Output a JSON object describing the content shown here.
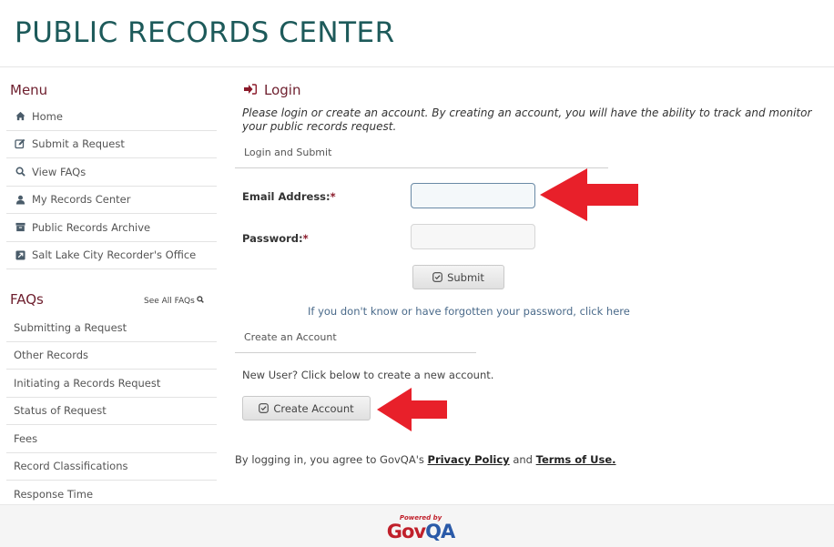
{
  "header": {
    "title": "PUBLIC RECORDS CENTER"
  },
  "sidebar": {
    "menu_title": "Menu",
    "menu_items": [
      {
        "label": "Home",
        "icon": "home-icon"
      },
      {
        "label": "Submit a Request",
        "icon": "edit-icon"
      },
      {
        "label": "View FAQs",
        "icon": "search-icon"
      },
      {
        "label": "My Records Center",
        "icon": "user-icon"
      },
      {
        "label": "Public Records Archive",
        "icon": "archive-icon"
      },
      {
        "label": "Salt Lake City Recorder's Office",
        "icon": "external-link-icon"
      }
    ],
    "faq_title": "FAQs",
    "see_all_label": "See All FAQs",
    "faq_items": [
      "Submitting a Request",
      "Other Records",
      "Initiating a Records Request",
      "Status of Request",
      "Fees",
      "Record Classifications",
      "Response Time"
    ]
  },
  "main": {
    "heading": "Login",
    "intro": "Please login or create an account. By creating an account, you will have the ability to track and monitor your public records request.",
    "login_section_label": "Login and Submit",
    "email_label": "Email Address:",
    "password_label": "Password:",
    "required_mark": "*",
    "email_value": "",
    "password_value": "",
    "submit_label": "Submit",
    "forgot_link": "If you don't know or have forgotten your password, click here",
    "create_section_label": "Create an Account",
    "new_user_text": "New User? Click below to create a new account.",
    "create_label": "Create Account",
    "agree_prefix": "By logging in, you agree to GovQA's ",
    "privacy_link": "Privacy Policy",
    "agree_and": " and ",
    "terms_link": "Terms of Use."
  },
  "footer": {
    "powered_by": "Powered by",
    "logo_gov": "Gov",
    "logo_qa": "QA"
  },
  "colors": {
    "title": "#1d5a5a",
    "section_heading": "#6e1f2e",
    "arrow": "#e8202a"
  }
}
